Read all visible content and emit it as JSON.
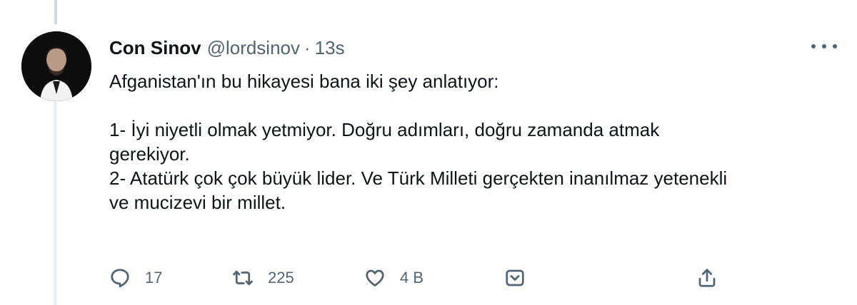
{
  "tweet": {
    "display_name": "Con Sinov",
    "handle": "@lordsinov",
    "separator": "·",
    "time": "13s",
    "text_lines": [
      "Afganistan'ın bu hikayesi bana iki şey anlatıyor:",
      "1- İyi niyetli olmak yetmiyor. Doğru adımları, doğru zamanda atmak",
      "gerekiyor.",
      "2- Atatürk çok çok büyük lider. Ve Türk Milleti gerçekten inanılmaz yetenekli",
      "ve mucizevi bir millet."
    ]
  },
  "actions": {
    "reply_count": "17",
    "retweet_count": "225",
    "like_count": "4 B"
  },
  "icons": {
    "reply": "reply-icon",
    "retweet": "retweet-icon",
    "like": "heart-icon",
    "bookmark": "bookmark-icon",
    "share": "share-icon",
    "more": "more-icon"
  },
  "colors": {
    "text": "#0f1419",
    "secondary": "#536471",
    "thread_line": "#cfd9de"
  }
}
